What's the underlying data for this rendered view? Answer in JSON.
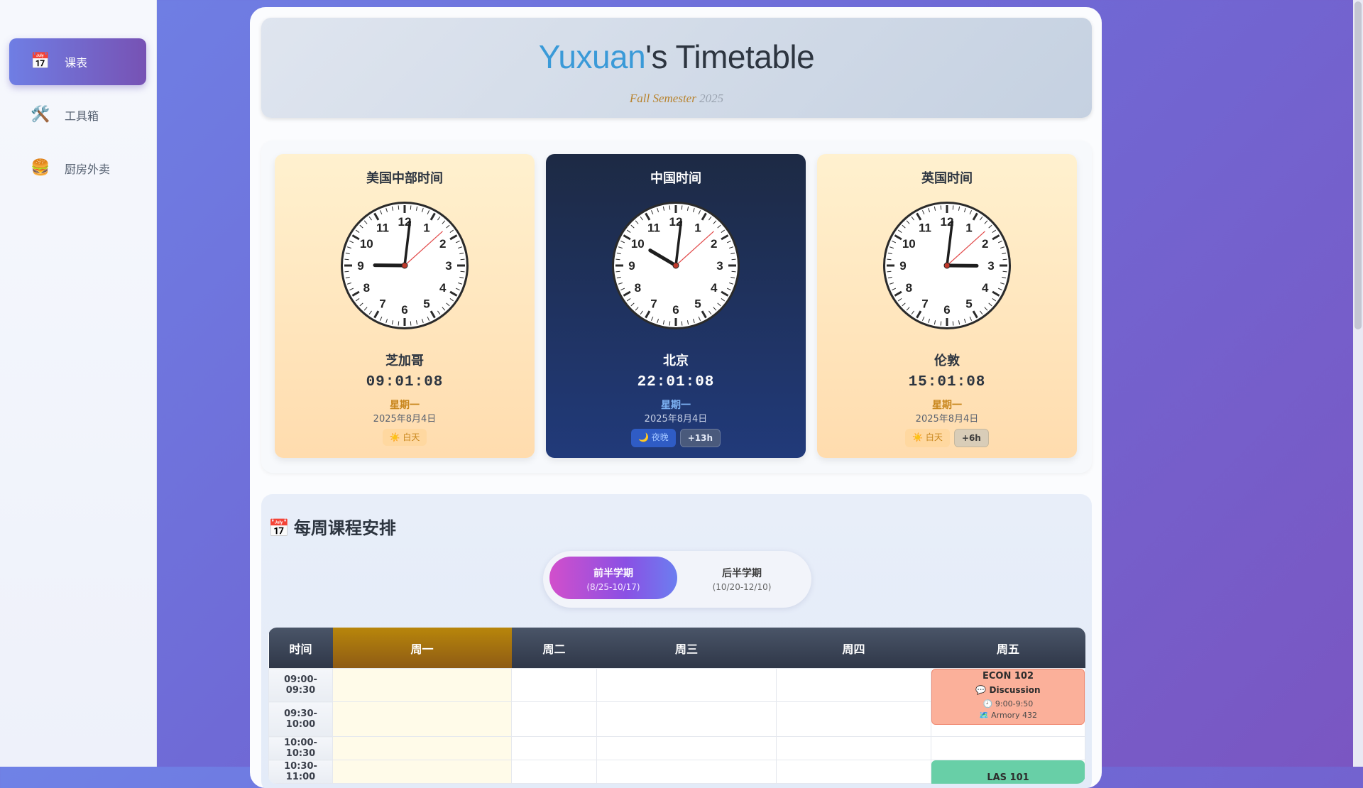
{
  "sidebar": {
    "items": [
      {
        "icon": "calendar-icon",
        "glyph": "📅",
        "label": "课表",
        "active": true
      },
      {
        "icon": "tools-icon",
        "glyph": "🛠️",
        "label": "工具箱",
        "active": false
      },
      {
        "icon": "burger-icon",
        "glyph": "🍔",
        "label": "厨房外卖",
        "active": false
      }
    ]
  },
  "header": {
    "title_name": "Yuxuan",
    "title_rest": "'s Timetable",
    "subtitle_sem": "Fall Semester",
    "subtitle_year": "2025"
  },
  "clocks": [
    {
      "zone": "美国中部时间",
      "city": "芝加哥",
      "time": "09:01:08",
      "weekday": "星期一",
      "date": "2025年8月4日",
      "period": "☀️ 白天",
      "offset": ""
    },
    {
      "zone": "中国时间",
      "city": "北京",
      "time": "22:01:08",
      "weekday": "星期一",
      "date": "2025年8月4日",
      "period": "🌙 夜晚",
      "offset": "+13h"
    },
    {
      "zone": "英国时间",
      "city": "伦敦",
      "time": "15:01:08",
      "weekday": "星期一",
      "date": "2025年8月4日",
      "period": "☀️ 白天",
      "offset": "+6h"
    }
  ],
  "schedule": {
    "title": "每周课程安排",
    "title_icon": "📅",
    "toggle": {
      "first_label": "前半学期",
      "first_range": "(8/25-10/17)",
      "second_label": "后半学期",
      "second_range": "(10/20-12/10)"
    },
    "columns": [
      "时间",
      "周一",
      "周二",
      "周三",
      "周四",
      "周五"
    ],
    "time_slots": [
      "09:00-09:30",
      "09:30-10:00",
      "10:00-10:30",
      "10:30-11:00"
    ],
    "courses": [
      {
        "code": "ECON 102",
        "type": "💬 Discussion",
        "time": "🕘 9:00-9:50",
        "location": "🗺️ Armory 432"
      },
      {
        "code": "LAS 101"
      }
    ]
  },
  "colors": {
    "accent": "#3a9ad8",
    "active_nav": "#7752b4",
    "today_header": "#b8860b",
    "course_discussion": "#fbb09a",
    "course_las": "#68cfa7"
  }
}
